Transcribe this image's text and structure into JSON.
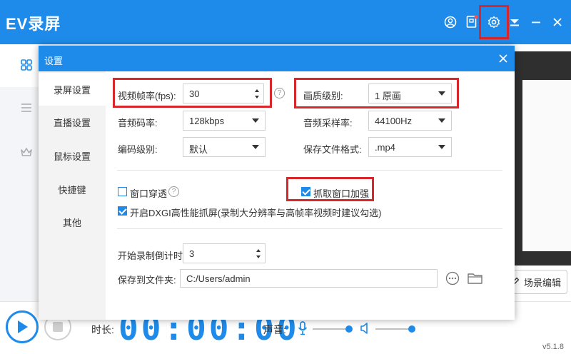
{
  "app": {
    "title": "EV录屏",
    "version": "v5.1.8"
  },
  "titlebar": {
    "icons": [
      "user-circle-icon",
      "notice-icon",
      "gear-icon",
      "menu-icon",
      "minimize-icon",
      "close-icon"
    ]
  },
  "main": {
    "scene_edit_label": "场景编辑",
    "duration_label": "时长:",
    "timer": "00:00:00",
    "sound_label": "声音:"
  },
  "dialog": {
    "title": "设置",
    "sidebar": [
      {
        "label": "录屏设置",
        "active": true
      },
      {
        "label": "直播设置",
        "active": false
      },
      {
        "label": "鼠标设置",
        "active": false
      },
      {
        "label": "快捷键",
        "active": false
      },
      {
        "label": "其他",
        "active": false
      }
    ],
    "fps": {
      "label": "视频帧率(fps):",
      "value": "30"
    },
    "quality": {
      "label": "画质级别:",
      "value": "1 原画"
    },
    "audio_bitrate": {
      "label": "音频码率:",
      "value": "128kbps"
    },
    "sample_rate": {
      "label": "音频采样率:",
      "value": "44100Hz"
    },
    "encode_level": {
      "label": "编码级别:",
      "value": "默认"
    },
    "file_format": {
      "label": "保存文件格式:",
      "value": ".mp4"
    },
    "window_through": {
      "label": "窗口穿透",
      "checked": false
    },
    "capture_enhance": {
      "label": "抓取窗口加强",
      "checked": true
    },
    "dxgi": {
      "label": "开启DXGI高性能抓屏(录制大分辨率与高帧率视频时建议勾选)",
      "checked": true
    },
    "countdown": {
      "label": "开始录制倒计时:",
      "value": "3"
    },
    "save_folder": {
      "label": "保存到文件夹:",
      "value": "C:/Users/admin"
    }
  },
  "colors": {
    "accent": "#1e8bea",
    "highlight": "#d8272b"
  }
}
